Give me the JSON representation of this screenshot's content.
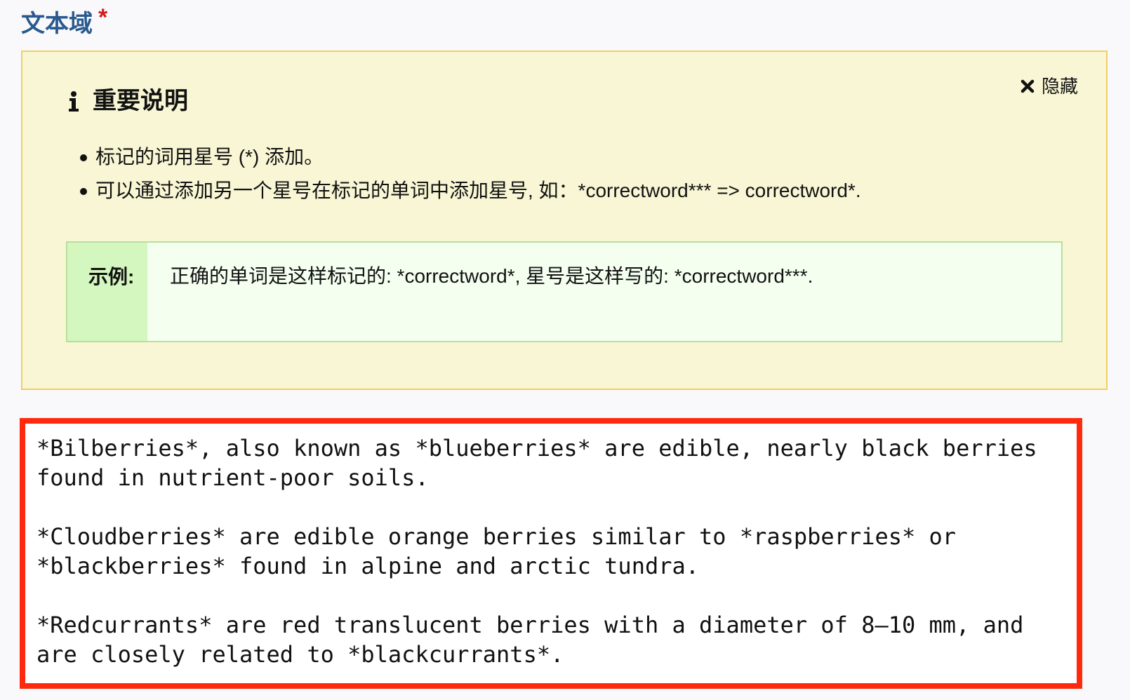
{
  "field": {
    "label": "文本域",
    "required_marker": "*"
  },
  "notice": {
    "title": "重要说明",
    "hide_label": "隐藏",
    "items": [
      "标记的词用星号 (*) 添加。",
      "可以通过添加另一个星号在标记的单词中添加星号, 如：*correctword*** => correctword*."
    ],
    "example": {
      "label": "示例:",
      "text": "正确的单词是这样标记的: *correctword*, 星号是这样写的: *correctword***."
    }
  },
  "textarea": {
    "value": "*Bilberries*, also known as *blueberries* are edible, nearly black berries found in nutrient-poor soils.\n\n*Cloudberries* are edible orange berries similar to *raspberries* or *blackberries* found in alpine and arctic tundra.\n\n*Redcurrants* are red translucent berries with a diameter of 8–10 mm, and are closely related to *blackcurrants*."
  },
  "colors": {
    "label_blue": "#2a5a8f",
    "required_red": "#d21b1b",
    "notice_bg": "#f8f6d4",
    "notice_border": "#f1cf67",
    "example_label_bg": "#d3f7bf",
    "example_bg": "#f4fff0",
    "textarea_border": "#ff2a0d"
  },
  "icons": {
    "info": "info-icon",
    "close": "close-icon"
  }
}
